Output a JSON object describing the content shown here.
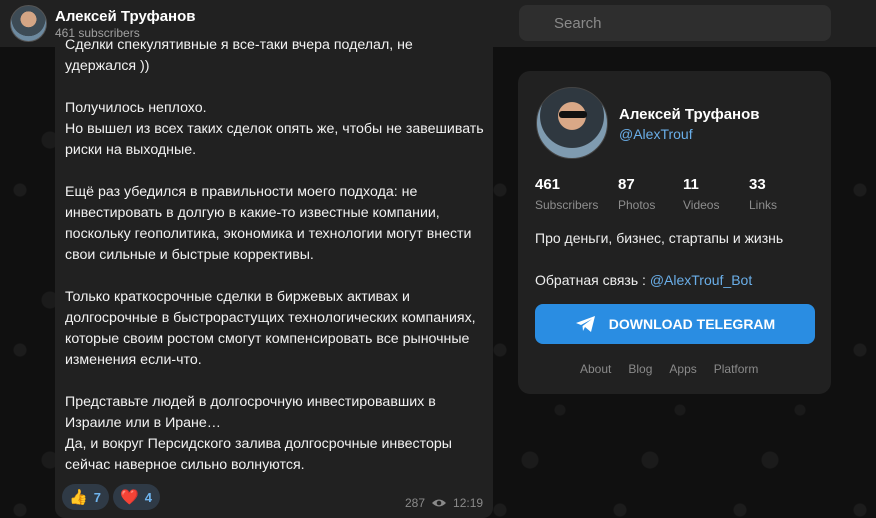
{
  "header": {
    "channel_name": "Алексей Труфанов",
    "subscribers": "461 subscribers",
    "search_placeholder": "Search"
  },
  "message": {
    "text": "Сделки спекулятивные я все-таки вчера поделал, не удержался ))\n\nПолучилось неплохо.\nНо вышел из всех таких сделок опять же, чтобы не завешивать риски на выходные.\n\nЕщё раз убедился в правильности моего подхода: не инвестировать в долгую в какие-то известные компании, поскольку геополитика, экономика и технологии могут внести свои сильные и быстрые коррективы.\n\nТолько краткосрочные сделки в биржевых активах и долгосрочные в быстрорастущих технологических компаниях, которые своим ростом смогут компенсировать все рыночные изменения если-что.\n\nПредставьте людей в долгосрочную инвестировавших в Израиле или в Иране…\nДа, и вокруг Персидского залива долгосрочные инвесторы сейчас наверное сильно волнуются.",
    "reactions": [
      {
        "emoji": "👍",
        "count": "7"
      },
      {
        "emoji": "❤️",
        "count": "4"
      }
    ],
    "views": "287",
    "time": "12:19"
  },
  "card": {
    "name": "Алексей Труфанов",
    "handle": "@AlexTrouf",
    "stats": [
      {
        "value": "461",
        "label": "Subscribers"
      },
      {
        "value": "87",
        "label": "Photos"
      },
      {
        "value": "11",
        "label": "Videos"
      },
      {
        "value": "33",
        "label": "Links"
      }
    ],
    "description": "Про деньги, бизнес, стартапы и жизнь",
    "feedback_label": "Обратная связь : ",
    "feedback_link": "@AlexTrouf_Bot",
    "download_button": "DOWNLOAD TELEGRAM",
    "footer_links": [
      "About",
      "Blog",
      "Apps",
      "Platform"
    ]
  }
}
